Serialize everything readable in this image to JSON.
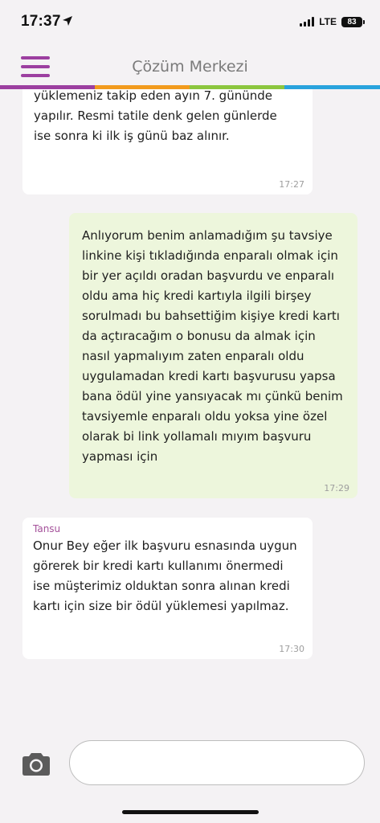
{
  "status_bar": {
    "time": "17:37",
    "network": "LTE",
    "battery": "83"
  },
  "header": {
    "title": "Çözüm Merkezi",
    "strip_colors": [
      "#9c3fa0",
      "#f29b1d",
      "#8cc63e",
      "#29a3dd"
    ]
  },
  "messages": [
    {
      "direction": "incoming",
      "sender": "",
      "text": "yüklemeniz takip eden ayın 7. gününde\nyapılır. Resmi tatile denk gelen günlerde\nise sonra ki ilk iş günü baz alınır.",
      "time": "17:27"
    },
    {
      "direction": "outgoing",
      "sender": "",
      "text": "Anlıyorum benim anlamadığım şu tavsiye\nlinkine kişi tıkladığında enparalı olmak için\nbir yer açıldı oradan başvurdu ve enparalı\noldu ama hiç kredi kartıyla ilgili birşey\nsorulmadı bu bahsettiğim kişiye kredi kartı\nda açtıracağım o bonusu da almak için\nnasıl yapmalıyım zaten enparalı oldu\nuygulamadan kredi kartı başvurusu yapsa\nbana ödül yine yansıyacak mı çünkü benim\ntavsiyemle enparalı oldu yoksa yine özel\nolarak bi link yollamalı mıyım başvuru\nyapması için",
      "time": "17:29"
    },
    {
      "direction": "incoming",
      "sender": "Tansu",
      "text": "Onur Bey eğer ilk başvuru esnasında uygun\ngörerek bir kredi kartı kullanımı önermedi\nise müşterimiz olduktan sonra alınan kredi\nkartı için size bir ödül yüklemesi yapılmaz.",
      "time": "17:30"
    }
  ],
  "input": {
    "placeholder": "",
    "value": ""
  },
  "icons": {
    "menu": "hamburger-menu-icon",
    "camera": "camera-icon",
    "location": "location-arrow-icon"
  }
}
